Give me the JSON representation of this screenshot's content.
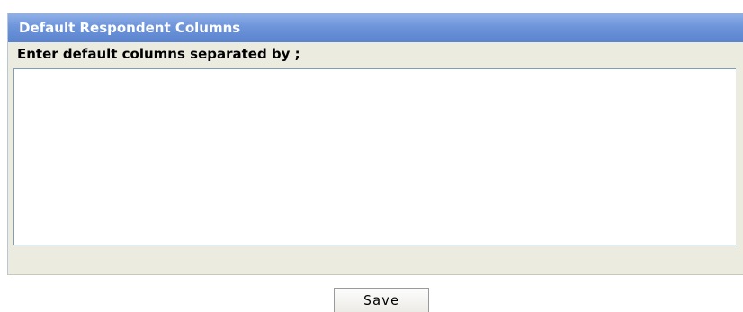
{
  "panel": {
    "title": "Default Respondent Columns",
    "field_label": "Enter default columns separated by ;",
    "columns_value": ""
  },
  "actions": {
    "save_label": "Save"
  },
  "colors": {
    "header_top": "#90b0e8",
    "header_bottom": "#5b84cf",
    "panel_background": "#ecebe0",
    "input_border": "#7f9db9"
  }
}
